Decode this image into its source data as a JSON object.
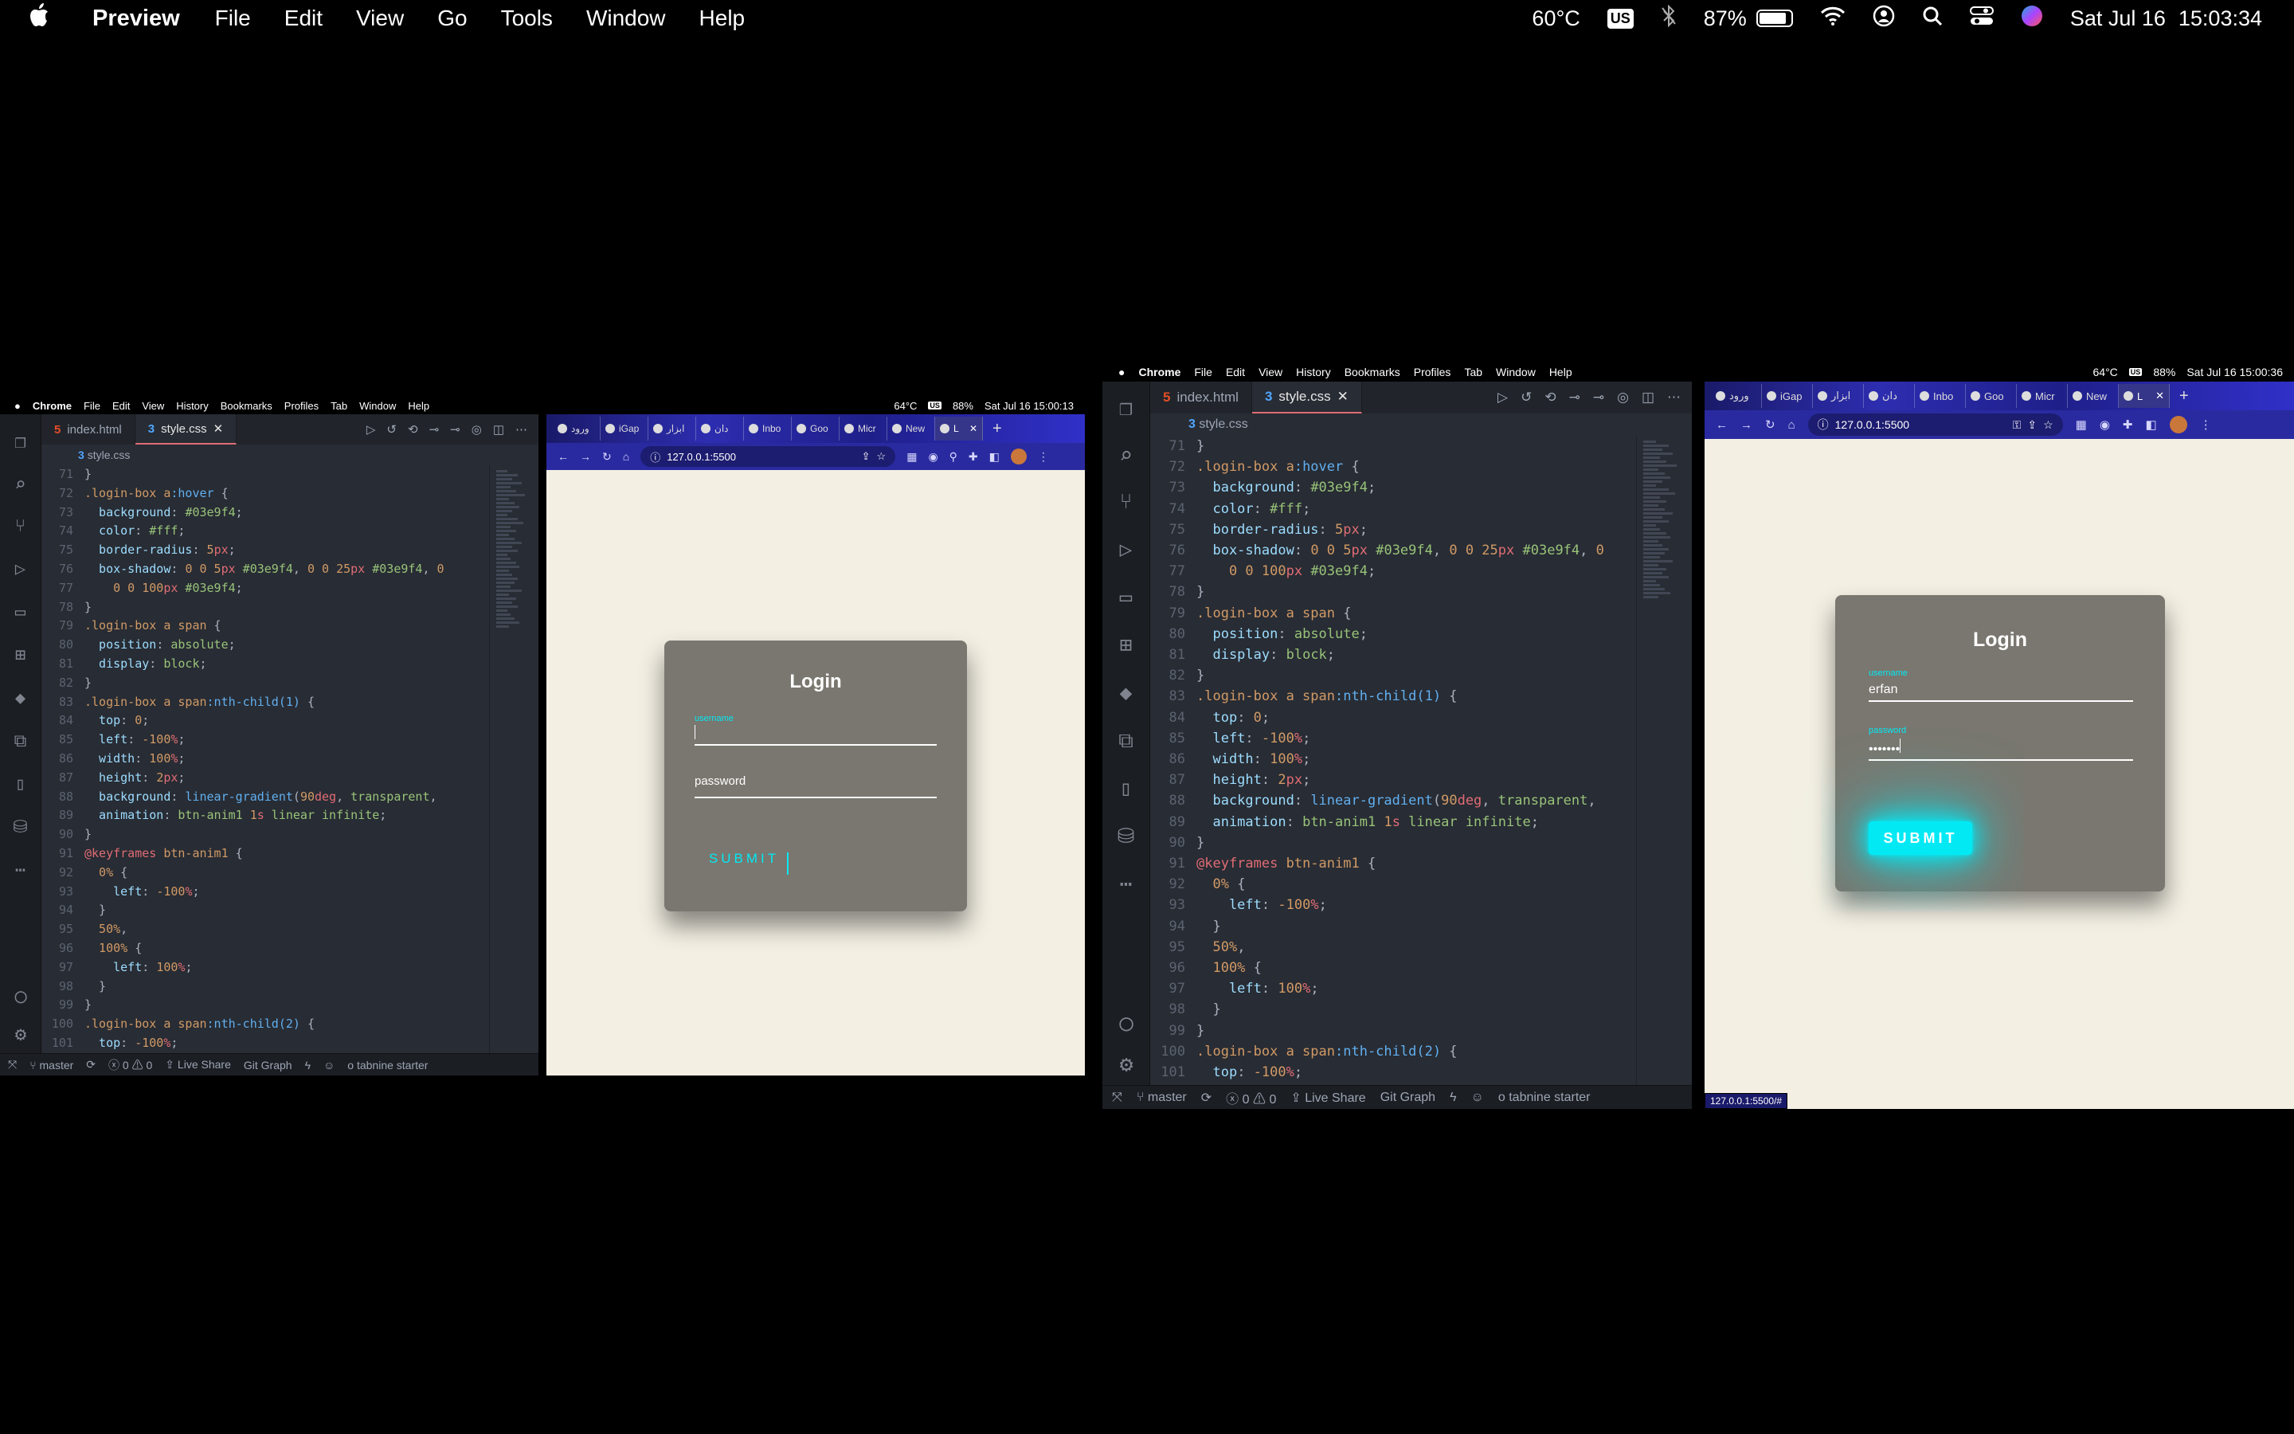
{
  "menubar": {
    "app": "Preview",
    "items": [
      "File",
      "Edit",
      "View",
      "Go",
      "Tools",
      "Window",
      "Help"
    ],
    "temp": "60°C",
    "input_source": "US",
    "battery": "87%",
    "battery_level": 0.87,
    "date": "Sat Jul 16",
    "time": "15:03:34"
  },
  "left_shot": {
    "menubar": {
      "app": "Chrome",
      "items": [
        "File",
        "Edit",
        "View",
        "History",
        "Bookmarks",
        "Profiles",
        "Tab",
        "Window",
        "Help"
      ],
      "temp": "64°C",
      "input_source": "US",
      "battery": "88%",
      "datetime": "Sat Jul 16  15:00:13"
    },
    "editor": {
      "tabs": [
        "index.html",
        "style.css"
      ],
      "breadcrumb": "style.css",
      "status": {
        "branch": "master",
        "errors": "0",
        "warnings": "0",
        "live_share": "Live Share",
        "git_graph": "Git Graph",
        "tabnine": "tabnine starter"
      }
    },
    "browser": {
      "tabs": [
        "ورود",
        "iGap",
        "ابزار",
        "دان",
        "Inbo",
        "Goo",
        "Micr",
        "New",
        "L"
      ],
      "url": "127.0.0.1:5500",
      "login": {
        "title": "Login",
        "username_label": "username",
        "username_value": "",
        "password_placeholder": "password",
        "password_value": "",
        "button": "SUBMIT"
      }
    }
  },
  "right_shot": {
    "menubar": {
      "app": "Chrome",
      "items": [
        "File",
        "Edit",
        "View",
        "History",
        "Bookmarks",
        "Profiles",
        "Tab",
        "Window",
        "Help"
      ],
      "temp": "64°C",
      "input_source": "US",
      "battery": "88%",
      "datetime": "Sat Jul 16  15:00:36"
    },
    "editor": {
      "tabs": [
        "index.html",
        "style.css"
      ],
      "breadcrumb": "style.css",
      "status": {
        "branch": "master",
        "errors": "0",
        "warnings": "0",
        "live_share": "Live Share",
        "git_graph": "Git Graph",
        "tabnine": "tabnine starter"
      }
    },
    "browser": {
      "tabs": [
        "ورود",
        "iGap",
        "ابزار",
        "دان",
        "Inbo",
        "Goo",
        "Micr",
        "New",
        "L"
      ],
      "url": "127.0.0.1:5500",
      "status_url": "127.0.0.1:5500/#",
      "login": {
        "title": "Login",
        "username_label": "username",
        "username_value": "erfan",
        "password_label": "password",
        "password_value": "•••••••",
        "button": "SUBMIT"
      }
    }
  },
  "code": [
    {
      "n": "71",
      "t": [
        [
          "pu",
          "}"
        ]
      ]
    },
    {
      "n": "72",
      "t": [
        [
          "sel",
          ".login-box a"
        ],
        [
          "fn",
          ":hover"
        ],
        [
          "pu",
          " {"
        ]
      ]
    },
    {
      "n": "73",
      "t": [
        [
          "pr",
          "  background"
        ],
        [
          "pu",
          ": "
        ],
        [
          "vl",
          "#03e9f4"
        ],
        [
          "pu",
          ";"
        ]
      ]
    },
    {
      "n": "74",
      "t": [
        [
          "pr",
          "  color"
        ],
        [
          "pu",
          ": "
        ],
        [
          "vl",
          "#fff"
        ],
        [
          "pu",
          ";"
        ]
      ]
    },
    {
      "n": "75",
      "t": [
        [
          "pr",
          "  border-radius"
        ],
        [
          "pu",
          ": "
        ],
        [
          "num",
          "5"
        ],
        [
          "un",
          "px"
        ],
        [
          "pu",
          ";"
        ]
      ]
    },
    {
      "n": "76",
      "t": [
        [
          "pr",
          "  box-shadow"
        ],
        [
          "pu",
          ": "
        ],
        [
          "num",
          "0 0 5"
        ],
        [
          "un",
          "px"
        ],
        [
          "vl",
          " #03e9f4"
        ],
        [
          "pu",
          ", "
        ],
        [
          "num",
          "0 0 25"
        ],
        [
          "un",
          "px"
        ],
        [
          "vl",
          " #03e9f4"
        ],
        [
          "pu",
          ", "
        ],
        [
          "num",
          "0"
        ]
      ]
    },
    {
      "n": "77",
      "t": [
        [
          "num",
          "    0 0 100"
        ],
        [
          "un",
          "px"
        ],
        [
          "vl",
          " #03e9f4"
        ],
        [
          "pu",
          ";"
        ]
      ]
    },
    {
      "n": "78",
      "t": [
        [
          "pu",
          "}"
        ]
      ]
    },
    {
      "n": "79",
      "t": [
        [
          "sel",
          ".login-box a span"
        ],
        [
          "pu",
          " {"
        ]
      ]
    },
    {
      "n": "80",
      "t": [
        [
          "pr",
          "  position"
        ],
        [
          "pu",
          ": "
        ],
        [
          "vl",
          "absolute"
        ],
        [
          "pu",
          ";"
        ]
      ]
    },
    {
      "n": "81",
      "t": [
        [
          "pr",
          "  display"
        ],
        [
          "pu",
          ": "
        ],
        [
          "vl",
          "block"
        ],
        [
          "pu",
          ";"
        ]
      ]
    },
    {
      "n": "82",
      "t": [
        [
          "pu",
          "}"
        ]
      ]
    },
    {
      "n": "83",
      "t": [
        [
          "sel",
          ".login-box a span"
        ],
        [
          "fn",
          ":nth-child(1)"
        ],
        [
          "pu",
          " {"
        ]
      ]
    },
    {
      "n": "84",
      "t": [
        [
          "pr",
          "  top"
        ],
        [
          "pu",
          ": "
        ],
        [
          "num",
          "0"
        ],
        [
          "pu",
          ";"
        ]
      ]
    },
    {
      "n": "85",
      "t": [
        [
          "pr",
          "  left"
        ],
        [
          "pu",
          ": "
        ],
        [
          "num",
          "-100"
        ],
        [
          "un",
          "%"
        ],
        [
          "pu",
          ";"
        ]
      ]
    },
    {
      "n": "86",
      "t": [
        [
          "pr",
          "  width"
        ],
        [
          "pu",
          ": "
        ],
        [
          "num",
          "100"
        ],
        [
          "un",
          "%"
        ],
        [
          "pu",
          ";"
        ]
      ]
    },
    {
      "n": "87",
      "t": [
        [
          "pr",
          "  height"
        ],
        [
          "pu",
          ": "
        ],
        [
          "num",
          "2"
        ],
        [
          "un",
          "px"
        ],
        [
          "pu",
          ";"
        ]
      ]
    },
    {
      "n": "88",
      "t": [
        [
          "pr",
          "  background"
        ],
        [
          "pu",
          ": "
        ],
        [
          "fn",
          "linear-gradient"
        ],
        [
          "pu",
          "("
        ],
        [
          "num",
          "90"
        ],
        [
          "un",
          "deg"
        ],
        [
          "pu",
          ", "
        ],
        [
          "vl",
          "transparent"
        ],
        [
          "pu",
          ","
        ]
      ]
    },
    {
      "n": "89",
      "t": [
        [
          "pr",
          "  animation"
        ],
        [
          "pu",
          ": "
        ],
        [
          "vl",
          "btn-anim1 "
        ],
        [
          "num",
          "1"
        ],
        [
          "un",
          "s"
        ],
        [
          "vl",
          " linear infinite"
        ],
        [
          "pu",
          ";"
        ]
      ]
    },
    {
      "n": "90",
      "t": [
        [
          "pu",
          "}"
        ]
      ]
    },
    {
      "n": "91",
      "t": [
        [
          "un",
          "@keyframes"
        ],
        [
          "sel",
          " btn-anim1"
        ],
        [
          "pu",
          " {"
        ]
      ]
    },
    {
      "n": "92",
      "t": [
        [
          "num",
          "  0%"
        ],
        [
          "pu",
          " {"
        ]
      ]
    },
    {
      "n": "93",
      "t": [
        [
          "pr",
          "    left"
        ],
        [
          "pu",
          ": "
        ],
        [
          "num",
          "-100"
        ],
        [
          "un",
          "%"
        ],
        [
          "pu",
          ";"
        ]
      ]
    },
    {
      "n": "94",
      "t": [
        [
          "pu",
          "  }"
        ]
      ]
    },
    {
      "n": "95",
      "t": [
        [
          "num",
          "  50%"
        ],
        [
          "pu",
          ","
        ]
      ]
    },
    {
      "n": "96",
      "t": [
        [
          "num",
          "  100%"
        ],
        [
          "pu",
          " {"
        ]
      ]
    },
    {
      "n": "97",
      "t": [
        [
          "pr",
          "    left"
        ],
        [
          "pu",
          ": "
        ],
        [
          "num",
          "100"
        ],
        [
          "un",
          "%"
        ],
        [
          "pu",
          ";"
        ]
      ]
    },
    {
      "n": "98",
      "t": [
        [
          "pu",
          "  }"
        ]
      ]
    },
    {
      "n": "99",
      "t": [
        [
          "pu",
          "}"
        ]
      ]
    },
    {
      "n": "100",
      "t": [
        [
          "sel",
          ".login-box a span"
        ],
        [
          "fn",
          ":nth-child(2)"
        ],
        [
          "pu",
          " {"
        ]
      ]
    },
    {
      "n": "101",
      "t": [
        [
          "pr",
          "  top"
        ],
        [
          "pu",
          ": "
        ],
        [
          "num",
          "-100"
        ],
        [
          "un",
          "%"
        ],
        [
          "pu",
          ";"
        ]
      ]
    }
  ]
}
